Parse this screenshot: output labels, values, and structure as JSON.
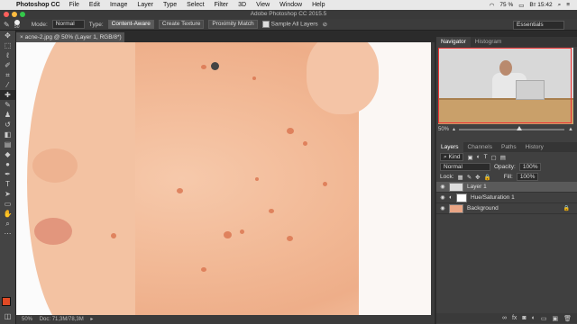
{
  "menubar": {
    "app": "Photoshop CC",
    "items": [
      "File",
      "Edit",
      "Image",
      "Layer",
      "Type",
      "Select",
      "Filter",
      "3D",
      "View",
      "Window",
      "Help"
    ],
    "battery": "75 %",
    "clock": "Вт 15:42"
  },
  "window": {
    "title": "Adobe Photoshop CC 2015.5"
  },
  "options": {
    "brush_size": "50",
    "mode_label": "Mode:",
    "mode_value": "Normal",
    "type_label": "Type:",
    "type_buttons": [
      "Content-Aware",
      "Create Texture",
      "Proximity Match"
    ],
    "sample_all": "Sample All Layers",
    "workspace": "Essentials"
  },
  "document": {
    "tab": "acne-2.jpg @ 50% (Layer 1, RGB/8*) *",
    "zoom": "50%",
    "doc_size": "Doc: 71,3M/78,3M"
  },
  "navigator": {
    "tabs": [
      "Navigator",
      "Histogram"
    ],
    "zoom": "50%"
  },
  "layers_panel": {
    "tabs": [
      "Layers",
      "Channels",
      "Paths",
      "History"
    ],
    "filter": "Kind",
    "blend_mode": "Normal",
    "opacity_label": "Opacity:",
    "opacity": "100%",
    "lock_label": "Lock:",
    "fill_label": "Fill:",
    "fill": "100%",
    "layers": [
      {
        "name": "Layer 1",
        "selected": true
      },
      {
        "name": "Hue/Saturation 1",
        "selected": false
      },
      {
        "name": "Background",
        "selected": false
      }
    ]
  }
}
